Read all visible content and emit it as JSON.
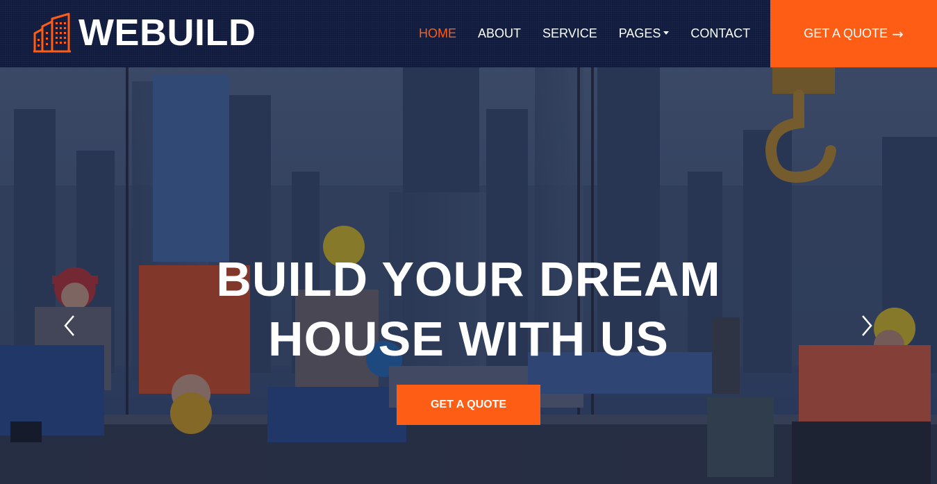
{
  "brand": {
    "name": "WEBUILD",
    "icon": "buildings-icon"
  },
  "nav": {
    "items": [
      {
        "label": "HOME",
        "active": true
      },
      {
        "label": "ABOUT",
        "active": false
      },
      {
        "label": "SERVICE",
        "active": false
      },
      {
        "label": "PAGES",
        "active": false,
        "dropdown": true
      },
      {
        "label": "CONTACT",
        "active": false
      }
    ],
    "quote_button": {
      "label": "GET A QUOTE",
      "icon": "arrow-right-icon"
    }
  },
  "hero": {
    "title_line1": "BUILD YOUR DREAM",
    "title_line2": "HOUSE WITH US",
    "button_label": "GET A QUOTE",
    "prev_icon": "chevron-left-icon",
    "next_icon": "chevron-right-icon"
  },
  "colors": {
    "accent": "#fd5d14",
    "navy": "#0f1a3d",
    "white": "#ffffff"
  }
}
